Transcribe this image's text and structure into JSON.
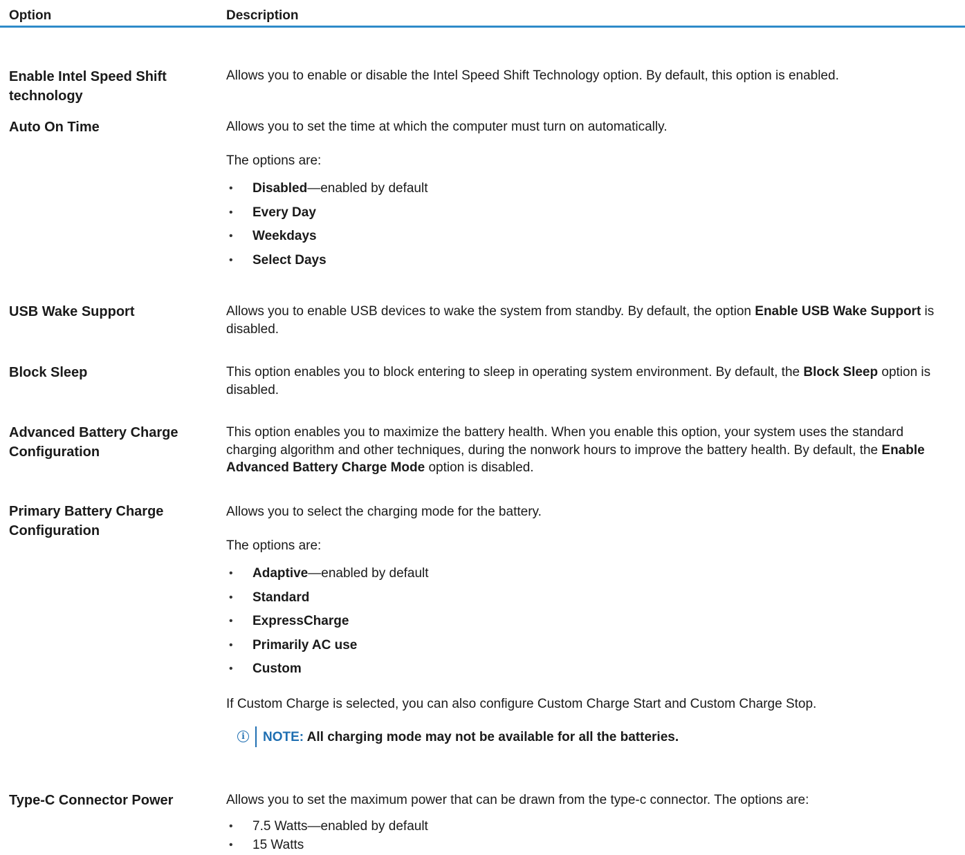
{
  "table": {
    "col_option": "Option",
    "col_description": "Description"
  },
  "rows": {
    "speed_shift": {
      "option": "Enable Intel Speed Shift technology",
      "desc": "Allows you to enable or disable the Intel Speed Shift Technology option. By default, this option is enabled."
    },
    "auto_on": {
      "option": "Auto On Time",
      "desc": "Allows you to set the time at which the computer must turn on automatically.",
      "options_intro": "The options are:",
      "items": [
        {
          "bold": "Disabled",
          "suffix": "—enabled by default"
        },
        {
          "bold": "Every Day",
          "suffix": ""
        },
        {
          "bold": "Weekdays",
          "suffix": ""
        },
        {
          "bold": "Select Days",
          "suffix": ""
        }
      ]
    },
    "usb_wake": {
      "option": "USB Wake Support",
      "desc_pre": "Allows you to enable USB devices to wake the system from standby. By default, the option ",
      "desc_bold": "Enable USB Wake Support",
      "desc_post": " is disabled."
    },
    "block_sleep": {
      "option": "Block Sleep",
      "desc_pre": "This option enables you to block entering to sleep in operating system environment. By default, the ",
      "desc_bold": "Block Sleep",
      "desc_post": " option is disabled."
    },
    "adv_battery": {
      "option": "Advanced Battery Charge Configuration",
      "desc_pre": "This option enables you to maximize the battery health. When you enable this option, your system uses the standard charging algorithm and other techniques, during the nonwork hours to improve the battery health. By default, the ",
      "desc_bold": "Enable Advanced Battery Charge Mode",
      "desc_post": " option is disabled."
    },
    "primary_battery": {
      "option": "Primary Battery Charge Configuration",
      "desc": "Allows you to select the charging mode for the battery.",
      "options_intro": "The options are:",
      "items": [
        {
          "bold": "Adaptive",
          "suffix": "—enabled by default"
        },
        {
          "bold": "Standard",
          "suffix": ""
        },
        {
          "bold": "ExpressCharge",
          "suffix": ""
        },
        {
          "bold": "Primarily AC use",
          "suffix": ""
        },
        {
          "bold": "Custom",
          "suffix": ""
        }
      ],
      "custom_note": "If Custom Charge is selected, you can also configure Custom Charge Start and Custom Charge Stop.",
      "note_label": "NOTE:",
      "note_text": " All charging mode may not be available for all the batteries.",
      "note_icon": "info-icon"
    },
    "typec": {
      "option": "Type-C Connector Power",
      "desc": "Allows you to set the maximum power that can be drawn from the type-c connector. The options are:",
      "items": [
        {
          "text": "7.5 Watts—enabled by default"
        },
        {
          "text": "15 Watts"
        }
      ]
    }
  },
  "colors": {
    "header_rule": "#2e8bc9",
    "note_accent": "#1f6fb2",
    "text": "#1a1a1a"
  }
}
